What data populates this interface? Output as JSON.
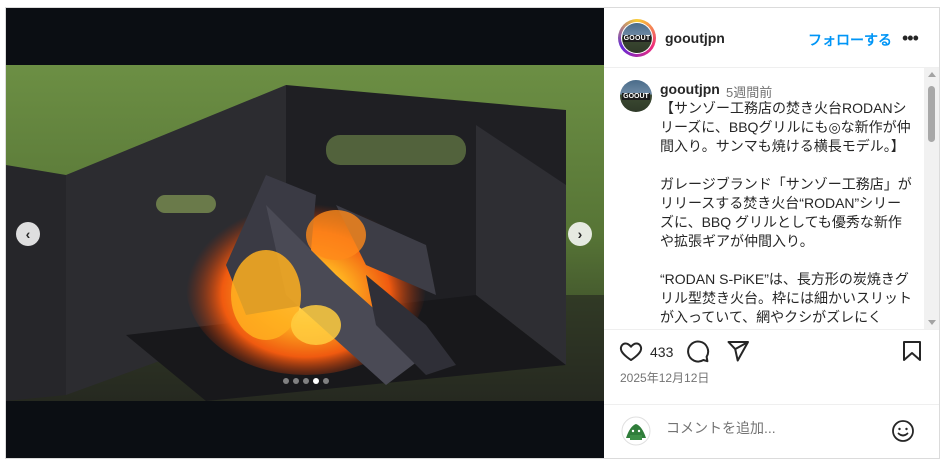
{
  "media": {
    "nav_prev": "‹",
    "nav_next": "›",
    "slide_count": 5,
    "active_slide_index": 3
  },
  "header": {
    "username": "gooutjpn",
    "follow_label": "フォローする",
    "more": "•••",
    "avatar_text": "GOOUT"
  },
  "caption": {
    "username": "gooutjpn",
    "time": "5週間前",
    "text": "【サンゾー工務店の焚き火台RODANシリーズに、BBQグリルにも◎な新作が仲間入り。サンマも焼ける横長モデル。】\n\nガレージブランド「サンゾー工務店」がリリースする焚き火台“RODAN”シリーズに、BBQ グリルとしても優秀な新作や拡張ギアが仲間入り。\n\n“RODAN S-PiKE”は、長方形の炭焼きグリル型焚き火台。枠には細かいスリットが入っていて、網やクシがズレにく"
  },
  "actions": {
    "like_count": "433",
    "date": "2025年12月12日"
  },
  "comment_bar": {
    "placeholder": "コメントを追加..."
  },
  "colors": {
    "follow": "#0095f6",
    "text": "#262626",
    "muted": "#737373",
    "media_bg": "#0b0e13"
  },
  "icons": {
    "like": "heart-icon",
    "comment": "comment-bubble-icon",
    "share": "paper-plane-icon",
    "save": "bookmark-icon",
    "emoji": "smiley-icon",
    "more": "ellipsis-icon"
  }
}
